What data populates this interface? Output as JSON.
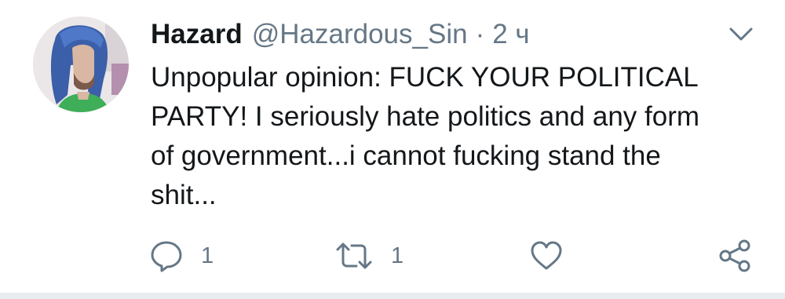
{
  "tweet": {
    "author_name": "Hazard",
    "handle": "@Hazardous_Sin",
    "separator": "·",
    "time": "2 ч",
    "text_lines": [
      "Unpopular opinion: FUCK YOUR POLITICAL",
      "PARTY! I seriously hate politics and any form",
      "of government...i cannot fucking stand the",
      "shit..."
    ]
  },
  "actions": {
    "reply": {
      "icon": "reply-icon",
      "count": "1"
    },
    "retweet": {
      "icon": "retweet-icon",
      "count": "1"
    },
    "like": {
      "icon": "heart-icon",
      "count": ""
    },
    "share": {
      "icon": "share-icon"
    }
  },
  "colors": {
    "primary_text": "#14171a",
    "secondary_text": "#657786",
    "divider": "#e6ecf0"
  }
}
